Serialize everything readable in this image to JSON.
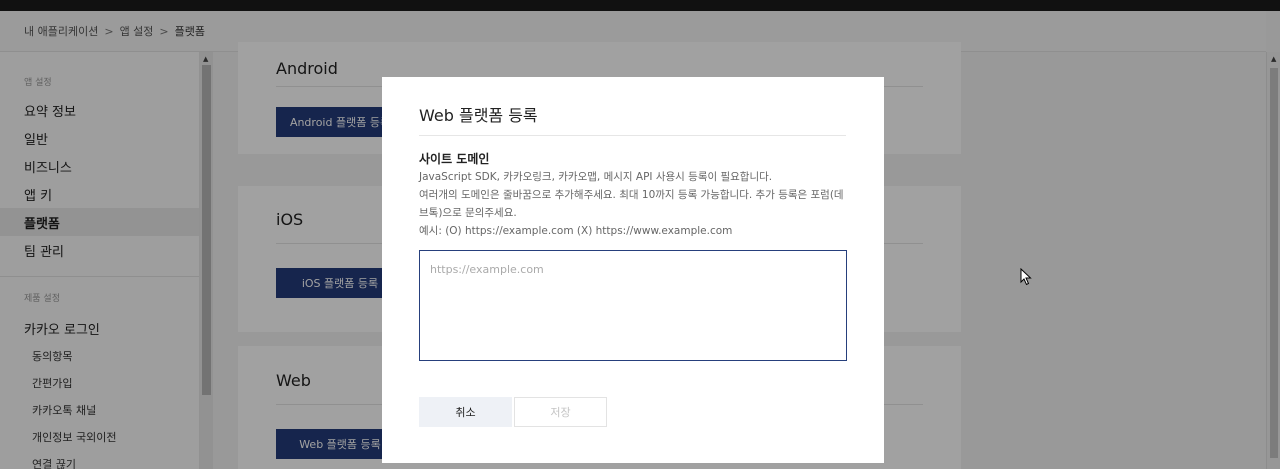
{
  "breadcrumb": {
    "items": [
      "내 애플리케이션",
      "앱 설정",
      "플랫폼"
    ],
    "separator": ">"
  },
  "sidebar": {
    "section1_label": "앱 설정",
    "items": [
      {
        "label": "요약 정보"
      },
      {
        "label": "일반"
      },
      {
        "label": "비즈니스"
      },
      {
        "label": "앱 키"
      },
      {
        "label": "플랫폼",
        "active": true
      },
      {
        "label": "팀 관리"
      }
    ],
    "section2_label": "제품 설정",
    "product_item": "카카오 로그인",
    "sub_items": [
      "동의항목",
      "간편가입",
      "카카오톡 채널",
      "개인정보 국외이전",
      "연결 끊기"
    ]
  },
  "platforms": {
    "android": {
      "title": "Android",
      "button": "Android 플랫폼 등록"
    },
    "ios": {
      "title": "iOS",
      "button": "iOS 플랫폼 등록"
    },
    "web": {
      "title": "Web",
      "button": "Web 플랫폼 등록"
    }
  },
  "modal": {
    "title": "Web 플랫폼 등록",
    "section_title": "사이트 도메인",
    "desc_line1": "JavaScript SDK, 카카오링크, 카카오맵, 메시지 API 사용시 등록이 필요합니다.",
    "desc_line2": "여러개의 도메인은 줄바꿈으로 추가해주세요. 최대 10까지 등록 가능합니다. 추가 등록은 포럼(데브톡)으로 문의주세요.",
    "desc_example": "예시: (O) https://example.com (X) https://www.example.com",
    "input_placeholder": "https://example.com",
    "input_value": "",
    "cancel_label": "취소",
    "save_label": "저장"
  },
  "colors": {
    "primary_button": "#233b7a",
    "input_border": "#263f7c",
    "overlay": "rgba(0,0,0,0.37)"
  }
}
